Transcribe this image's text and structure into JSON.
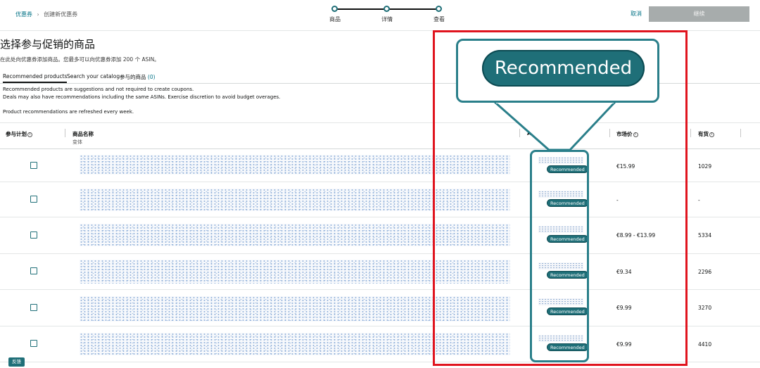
{
  "breadcrumb": {
    "root": "优惠券",
    "separator": "›",
    "current": "创建新优惠券"
  },
  "stepper": {
    "steps": [
      "商品",
      "详情",
      "查看"
    ]
  },
  "actions": {
    "cancel": "取消",
    "continue": "继续"
  },
  "page": {
    "title": "选择参与促销的商品",
    "subtitle": "在此处向优惠券添加商品。您最多可以向优惠券添加 200 个 ASIN。"
  },
  "tabs": [
    {
      "label": "Recommended products"
    },
    {
      "label": "Search your catalog"
    },
    {
      "label": "参与的商品",
      "count": "(0)"
    }
  ],
  "notes": [
    "Recommended products are suggestions and not required to create coupons.",
    "Deals may also have recommendations including the same ASINs. Exercise discretion to avoid budget overages.",
    "Product recommendations are refreshed every week."
  ],
  "table": {
    "headers": {
      "participate": "参与计划",
      "product_name": "商品名称",
      "product_sub": "变体",
      "asin": "ASIN",
      "market_price": "市场价",
      "in_stock": "有货"
    },
    "rows": [
      {
        "badge": "Recommended",
        "price": "€15.99",
        "stock": "1029"
      },
      {
        "badge": "Recommended",
        "price": "-",
        "stock": "-"
      },
      {
        "badge": "Recommended",
        "price": "€8.99 - €13.99",
        "stock": "5334"
      },
      {
        "badge": "Recommended",
        "price": "€9.34",
        "stock": "2296"
      },
      {
        "badge": "Recommended",
        "price": "€9.99",
        "stock": "3270"
      },
      {
        "badge": "Recommended",
        "price": "€9.99",
        "stock": "4410"
      }
    ]
  },
  "callout": {
    "label": "Recommended"
  },
  "feedback": {
    "label": "反馈"
  },
  "colors": {
    "accent": "#1f6f78",
    "link": "#007185",
    "highlight": "#e0141e"
  }
}
